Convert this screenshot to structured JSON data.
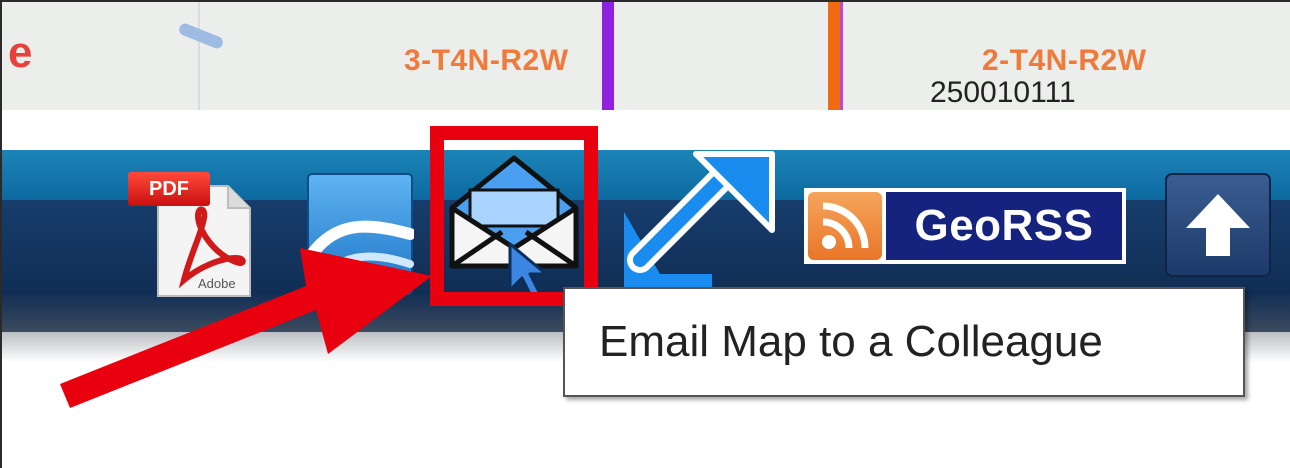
{
  "map": {
    "edge_letter": "e",
    "township_labels": [
      "3-T4N-R2W",
      "2-T4N-R2W"
    ],
    "parcel_number": "250010111"
  },
  "toolbar": {
    "pdf_icon_text": "PDF",
    "pdf_icon_sub": "Adobe",
    "georss_label": "GeoRSS",
    "tooltip": "Email Map to a Colleague"
  },
  "colors": {
    "highlight": "#e8000e",
    "toolbar_top": "#1c84b8",
    "toolbar_bottom": "#173d6c",
    "township_label": "#f07a3a"
  }
}
